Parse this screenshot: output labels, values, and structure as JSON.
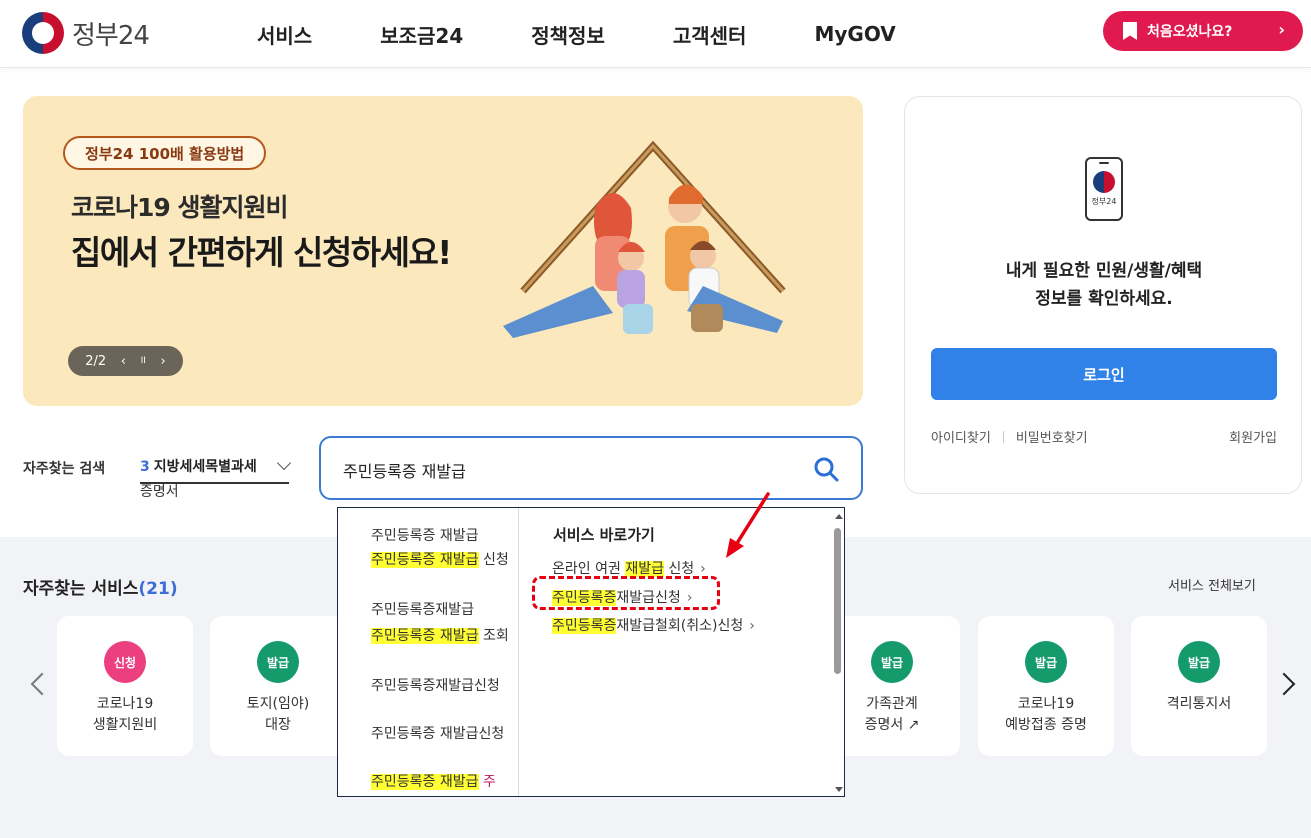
{
  "header": {
    "logo_text": "정부24",
    "nav": [
      "서비스",
      "보조금24",
      "정책정보",
      "고객센터",
      "MyGOV"
    ],
    "first_visit_label": "처음오셨나요?"
  },
  "banner": {
    "tag": "정부24 100배 활용방법",
    "subtitle": "코로나19 생활지원비",
    "title": "집에서 간편하게 신청하세요!",
    "pager": "2/2",
    "pager_prev": "‹",
    "pager_pause": "II",
    "pager_next": "›"
  },
  "login": {
    "phone_label": "정부24",
    "message_line1": "내게 필요한 민원/생활/혜택",
    "message_line2": "정보를 확인하세요.",
    "button": "로그인",
    "find_id": "아이디찾기",
    "find_pw": "비밀번호찾기",
    "join": "회원가입"
  },
  "search": {
    "freq_label": "자주찾는 검색",
    "freq_rank": "3",
    "freq_text": "지방세세목별과세",
    "freq_overflow": "증명서",
    "query": "주민등록증 재발급"
  },
  "autocomplete": {
    "suggestions": [
      {
        "hl": "",
        "rest": "주민등록증 재발급"
      },
      {
        "hl": "주민등록증 재발급",
        "rest": " 신청"
      },
      {
        "hl": "",
        "rest": "주민등록증재발급"
      },
      {
        "hl": "주민등록증 재발급",
        "rest": " 조회"
      },
      {
        "hl": "",
        "rest": "주민등록증재발급신청"
      },
      {
        "hl": "",
        "rest": "주민등록증 재발급신청"
      },
      {
        "hl": "주민등록증 재발급",
        "rest": " 주"
      }
    ],
    "shortcut_title": "서비스 바로가기",
    "shortcuts": [
      {
        "pre": "온라인 여권 ",
        "hl": "재발급",
        "post": " 신청"
      },
      {
        "pre": "",
        "hl": "주민등록증",
        "post": "재발급신청"
      },
      {
        "pre": "",
        "hl": "주민등록증",
        "post": "재발급철회(취소)신청"
      }
    ]
  },
  "services": {
    "title": "자주찾는 서비스",
    "count": "(21)",
    "view_all": "서비스 전체보기",
    "cards": [
      {
        "badge": "신청",
        "color": "#ec3f7f",
        "line1": "코로나19",
        "line2": "생활지원비"
      },
      {
        "badge": "발급",
        "color": "#159a6c",
        "line1": "토지(임야)",
        "line2": "대장"
      },
      {
        "badge": "발급",
        "color": "#159a6c",
        "line1": "가족관계",
        "line2": "증명서 ↗"
      },
      {
        "badge": "발급",
        "color": "#159a6c",
        "line1": "코로나19",
        "line2": "예방접종 증명"
      },
      {
        "badge": "발급",
        "color": "#159a6c",
        "line1": "격리통지서",
        "line2": ""
      }
    ]
  }
}
